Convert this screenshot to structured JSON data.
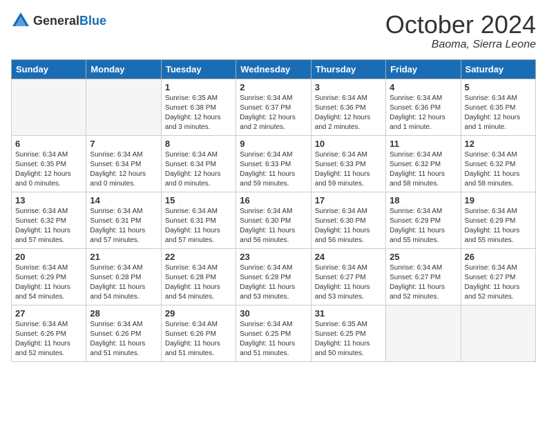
{
  "header": {
    "logo": {
      "general": "General",
      "blue": "Blue"
    },
    "title": "October 2024",
    "location": "Baoma, Sierra Leone"
  },
  "calendar": {
    "days_of_week": [
      "Sunday",
      "Monday",
      "Tuesday",
      "Wednesday",
      "Thursday",
      "Friday",
      "Saturday"
    ],
    "weeks": [
      [
        {
          "day": "",
          "empty": true
        },
        {
          "day": "",
          "empty": true
        },
        {
          "day": "1",
          "sunrise": "6:35 AM",
          "sunset": "6:38 PM",
          "daylight": "12 hours and 3 minutes."
        },
        {
          "day": "2",
          "sunrise": "6:34 AM",
          "sunset": "6:37 PM",
          "daylight": "12 hours and 2 minutes."
        },
        {
          "day": "3",
          "sunrise": "6:34 AM",
          "sunset": "6:36 PM",
          "daylight": "12 hours and 2 minutes."
        },
        {
          "day": "4",
          "sunrise": "6:34 AM",
          "sunset": "6:36 PM",
          "daylight": "12 hours and 1 minute."
        },
        {
          "day": "5",
          "sunrise": "6:34 AM",
          "sunset": "6:35 PM",
          "daylight": "12 hours and 1 minute."
        }
      ],
      [
        {
          "day": "6",
          "sunrise": "6:34 AM",
          "sunset": "6:35 PM",
          "daylight": "12 hours and 0 minutes."
        },
        {
          "day": "7",
          "sunrise": "6:34 AM",
          "sunset": "6:34 PM",
          "daylight": "12 hours and 0 minutes."
        },
        {
          "day": "8",
          "sunrise": "6:34 AM",
          "sunset": "6:34 PM",
          "daylight": "12 hours and 0 minutes."
        },
        {
          "day": "9",
          "sunrise": "6:34 AM",
          "sunset": "6:33 PM",
          "daylight": "11 hours and 59 minutes."
        },
        {
          "day": "10",
          "sunrise": "6:34 AM",
          "sunset": "6:33 PM",
          "daylight": "11 hours and 59 minutes."
        },
        {
          "day": "11",
          "sunrise": "6:34 AM",
          "sunset": "6:32 PM",
          "daylight": "11 hours and 58 minutes."
        },
        {
          "day": "12",
          "sunrise": "6:34 AM",
          "sunset": "6:32 PM",
          "daylight": "11 hours and 58 minutes."
        }
      ],
      [
        {
          "day": "13",
          "sunrise": "6:34 AM",
          "sunset": "6:32 PM",
          "daylight": "11 hours and 57 minutes."
        },
        {
          "day": "14",
          "sunrise": "6:34 AM",
          "sunset": "6:31 PM",
          "daylight": "11 hours and 57 minutes."
        },
        {
          "day": "15",
          "sunrise": "6:34 AM",
          "sunset": "6:31 PM",
          "daylight": "11 hours and 57 minutes."
        },
        {
          "day": "16",
          "sunrise": "6:34 AM",
          "sunset": "6:30 PM",
          "daylight": "11 hours and 56 minutes."
        },
        {
          "day": "17",
          "sunrise": "6:34 AM",
          "sunset": "6:30 PM",
          "daylight": "11 hours and 56 minutes."
        },
        {
          "day": "18",
          "sunrise": "6:34 AM",
          "sunset": "6:29 PM",
          "daylight": "11 hours and 55 minutes."
        },
        {
          "day": "19",
          "sunrise": "6:34 AM",
          "sunset": "6:29 PM",
          "daylight": "11 hours and 55 minutes."
        }
      ],
      [
        {
          "day": "20",
          "sunrise": "6:34 AM",
          "sunset": "6:29 PM",
          "daylight": "11 hours and 54 minutes."
        },
        {
          "day": "21",
          "sunrise": "6:34 AM",
          "sunset": "6:28 PM",
          "daylight": "11 hours and 54 minutes."
        },
        {
          "day": "22",
          "sunrise": "6:34 AM",
          "sunset": "6:28 PM",
          "daylight": "11 hours and 54 minutes."
        },
        {
          "day": "23",
          "sunrise": "6:34 AM",
          "sunset": "6:28 PM",
          "daylight": "11 hours and 53 minutes."
        },
        {
          "day": "24",
          "sunrise": "6:34 AM",
          "sunset": "6:27 PM",
          "daylight": "11 hours and 53 minutes."
        },
        {
          "day": "25",
          "sunrise": "6:34 AM",
          "sunset": "6:27 PM",
          "daylight": "11 hours and 52 minutes."
        },
        {
          "day": "26",
          "sunrise": "6:34 AM",
          "sunset": "6:27 PM",
          "daylight": "11 hours and 52 minutes."
        }
      ],
      [
        {
          "day": "27",
          "sunrise": "6:34 AM",
          "sunset": "6:26 PM",
          "daylight": "11 hours and 52 minutes."
        },
        {
          "day": "28",
          "sunrise": "6:34 AM",
          "sunset": "6:26 PM",
          "daylight": "11 hours and 51 minutes."
        },
        {
          "day": "29",
          "sunrise": "6:34 AM",
          "sunset": "6:26 PM",
          "daylight": "11 hours and 51 minutes."
        },
        {
          "day": "30",
          "sunrise": "6:34 AM",
          "sunset": "6:25 PM",
          "daylight": "11 hours and 51 minutes."
        },
        {
          "day": "31",
          "sunrise": "6:35 AM",
          "sunset": "6:25 PM",
          "daylight": "11 hours and 50 minutes."
        },
        {
          "day": "",
          "empty": true
        },
        {
          "day": "",
          "empty": true
        }
      ]
    ]
  }
}
